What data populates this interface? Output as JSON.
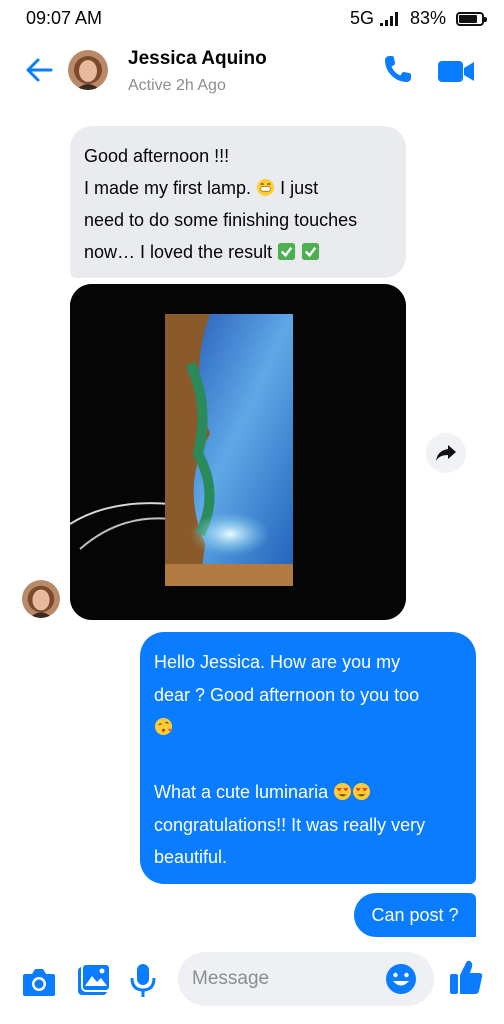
{
  "status_bar": {
    "time": "09:07 AM",
    "network": "5G",
    "battery": "83%",
    "battery_level": 0.83
  },
  "header": {
    "name": "Jessica Aquino",
    "status": "Active 2h Ago"
  },
  "messages": {
    "received_text": [
      "Good afternoon !!!",
      "I made my first lamp.",
      " I just",
      "need to do some finishing touches",
      "now… I loved the result"
    ],
    "sent_text": [
      "Hello Jessica. How are you my",
      "dear ? Good afternoon to you too",
      "",
      "",
      "What a cute luminaria",
      "congratulations!! It was really very",
      "beautiful."
    ],
    "sent_short": "Can post ?"
  },
  "composer": {
    "placeholder": "Message"
  },
  "colors": {
    "accent": "#0a7cff",
    "received_bubble": "#e9ebee",
    "muted_text": "#8a8d91"
  },
  "icons": [
    "back-arrow-icon",
    "phone-icon",
    "video-camera-icon",
    "share-arrow-icon",
    "camera-icon",
    "gallery-icon",
    "microphone-icon",
    "emoji-icon",
    "thumbs-up-icon"
  ]
}
